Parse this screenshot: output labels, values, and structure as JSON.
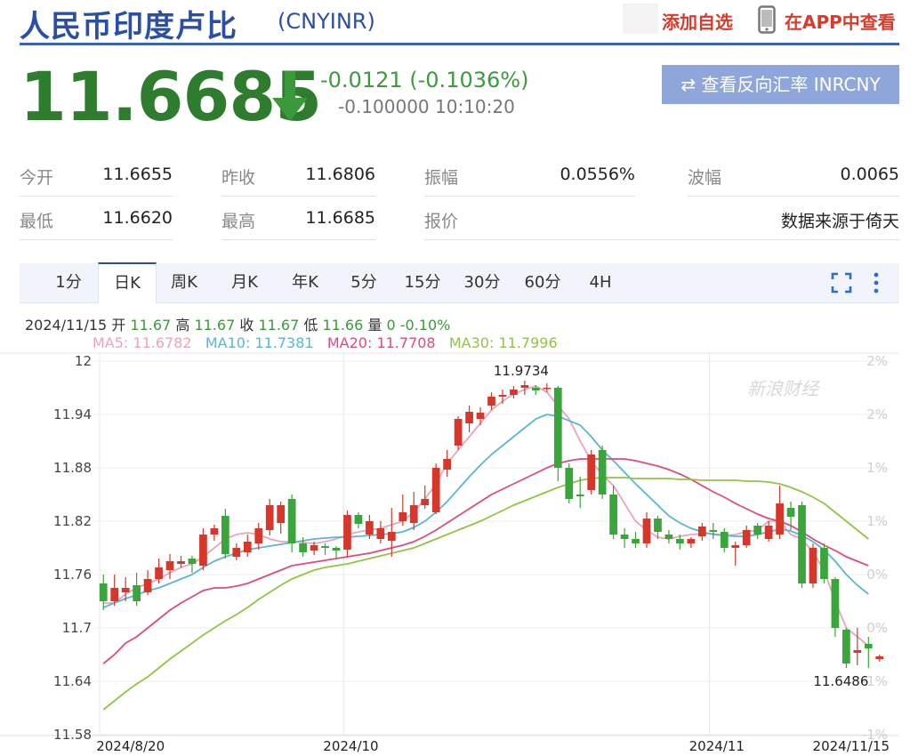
{
  "header": {
    "title": "人民币印度卢比",
    "code": "(CNYINR)",
    "add_watch": "添加自选",
    "app_view": "在APP中查看"
  },
  "quote": {
    "price": "11.6685",
    "change": "-0.0121 (-0.1036%)",
    "sub": "-0.100000 10:10:20",
    "reverse_label": "⇄ 查看反向汇率 INRCNY",
    "direction": "down",
    "color_down": "#2e7d2e"
  },
  "stats": {
    "open_label": "今开",
    "open": "11.6655",
    "prev_close_label": "昨收",
    "prev_close": "11.6806",
    "amplitude_label": "振幅",
    "amplitude": "0.0556%",
    "wave_label": "波幅",
    "wave": "0.0065",
    "low_label": "最低",
    "low": "11.6620",
    "high_label": "最高",
    "high": "11.6685",
    "quote_label": "报价",
    "source": "数据来源于倚天"
  },
  "tabs": [
    "1分",
    "日K",
    "周K",
    "月K",
    "年K",
    "5分",
    "15分",
    "30分",
    "60分",
    "4H"
  ],
  "active_tab": "日K",
  "chart_info": {
    "date": "2024/11/15",
    "open_label": "开",
    "open": "11.67",
    "high_label": "高",
    "high": "11.67",
    "close_label": "收",
    "close": "11.67",
    "low_label": "低",
    "low": "11.66",
    "vol_label": "量",
    "vol": "0",
    "pct": "-0.10%",
    "ma5": "MA5: 11.6782",
    "ma10": "MA10: 11.7381",
    "ma20": "MA20: 11.7708",
    "ma30": "MA30: 11.7996"
  },
  "chart_data": {
    "type": "candlestick",
    "watermark": "新浪财经",
    "ylim": [
      11.58,
      12.0
    ],
    "yticks": [
      "12",
      "11.94",
      "11.88",
      "11.82",
      "11.76",
      "11.7",
      "11.64",
      "11.58"
    ],
    "pct_ticks": [
      "2%",
      "2%",
      "1%",
      "1%",
      "0%",
      "0%",
      "-1%",
      "-1%"
    ],
    "xticks": [
      "2024/8/20",
      "2024/10",
      "2024/11",
      "2024/11/15"
    ],
    "max_label": "11.9734",
    "min_label": "11.6486",
    "colors": {
      "up": "#d6372a",
      "down": "#3aa53a",
      "ma5": "#eea3b8",
      "ma10": "#58b6d6",
      "ma20": "#dd4c7c",
      "ma30": "#93c446"
    },
    "candles": [
      [
        11.75,
        11.73,
        11.76,
        11.72
      ],
      [
        11.73,
        11.745,
        11.76,
        11.725
      ],
      [
        11.74,
        11.745,
        11.757,
        11.73
      ],
      [
        11.748,
        11.73,
        11.762,
        11.725
      ],
      [
        11.74,
        11.755,
        11.765,
        11.737
      ],
      [
        11.755,
        11.768,
        11.778,
        11.75
      ],
      [
        11.765,
        11.775,
        11.783,
        11.755
      ],
      [
        11.772,
        11.775,
        11.781,
        11.768
      ],
      [
        11.778,
        11.772,
        11.781,
        11.762
      ],
      [
        11.77,
        11.805,
        11.812,
        11.765
      ],
      [
        11.805,
        11.812,
        11.816,
        11.798
      ],
      [
        11.826,
        11.783,
        11.834,
        11.778
      ],
      [
        11.78,
        11.79,
        11.795,
        11.776
      ],
      [
        11.785,
        11.797,
        11.805,
        11.78
      ],
      [
        11.795,
        11.812,
        11.818,
        11.788
      ],
      [
        11.81,
        11.838,
        11.845,
        11.804
      ],
      [
        11.818,
        11.838,
        11.842,
        11.806
      ],
      [
        11.845,
        11.795,
        11.85,
        11.785
      ],
      [
        11.795,
        11.785,
        11.802,
        11.78
      ],
      [
        11.787,
        11.793,
        11.797,
        11.782
      ],
      [
        11.792,
        11.79,
        11.795,
        11.782
      ],
      [
        11.79,
        11.787,
        11.792,
        11.778
      ],
      [
        11.788,
        11.827,
        11.832,
        11.78
      ],
      [
        11.827,
        11.817,
        11.83,
        11.812
      ],
      [
        11.805,
        11.82,
        11.827,
        11.8
      ],
      [
        11.8,
        11.812,
        11.82,
        11.795
      ],
      [
        11.798,
        11.808,
        11.835,
        11.78
      ],
      [
        11.82,
        11.83,
        11.85,
        11.815
      ],
      [
        11.818,
        11.838,
        11.853,
        11.81
      ],
      [
        11.838,
        11.845,
        11.86,
        11.834
      ],
      [
        11.83,
        11.88,
        11.885,
        11.828
      ],
      [
        11.878,
        11.89,
        11.9,
        11.87
      ],
      [
        11.905,
        11.935,
        11.938,
        11.9
      ],
      [
        11.93,
        11.943,
        11.95,
        11.92
      ],
      [
        11.935,
        11.942,
        11.948,
        11.928
      ],
      [
        11.95,
        11.96,
        11.965,
        11.945
      ],
      [
        11.96,
        11.962,
        11.968,
        11.952
      ],
      [
        11.962,
        11.968,
        11.972,
        11.958
      ],
      [
        11.97,
        11.973,
        11.978,
        11.962
      ],
      [
        11.97,
        11.967,
        11.973,
        11.962
      ],
      [
        11.97,
        11.97,
        11.975,
        11.965
      ],
      [
        11.97,
        11.88,
        11.972,
        11.865
      ],
      [
        11.88,
        11.845,
        11.885,
        11.84
      ],
      [
        11.85,
        11.848,
        11.87,
        11.835
      ],
      [
        11.855,
        11.895,
        11.9,
        11.85
      ],
      [
        11.9,
        11.85,
        11.905,
        11.845
      ],
      [
        11.85,
        11.805,
        11.86,
        11.8
      ],
      [
        11.805,
        11.8,
        11.812,
        11.79
      ],
      [
        11.8,
        11.795,
        11.808,
        11.79
      ],
      [
        11.795,
        11.823,
        11.83,
        11.79
      ],
      [
        11.823,
        11.808,
        11.826,
        11.8
      ],
      [
        11.805,
        11.8,
        11.81,
        11.795
      ],
      [
        11.8,
        11.795,
        11.805,
        11.788
      ],
      [
        11.795,
        11.8,
        11.802,
        11.79
      ],
      [
        11.803,
        11.814,
        11.818,
        11.798
      ],
      [
        11.81,
        11.808,
        11.818,
        11.8
      ],
      [
        11.808,
        11.79,
        11.812,
        11.785
      ],
      [
        11.79,
        11.793,
        11.797,
        11.77
      ],
      [
        11.793,
        11.81,
        11.815,
        11.79
      ],
      [
        11.815,
        11.805,
        11.818,
        11.8
      ],
      [
        11.8,
        11.815,
        11.82,
        11.797
      ],
      [
        11.805,
        11.84,
        11.86,
        11.8
      ],
      [
        11.835,
        11.825,
        11.842,
        11.81
      ],
      [
        11.838,
        11.75,
        11.842,
        11.745
      ],
      [
        11.75,
        11.79,
        11.795,
        11.745
      ],
      [
        11.79,
        11.755,
        11.795,
        11.75
      ],
      [
        11.755,
        11.7,
        11.757,
        11.69
      ],
      [
        11.698,
        11.66,
        11.7,
        11.655
      ],
      [
        11.672,
        11.675,
        11.7,
        11.658
      ],
      [
        11.682,
        11.677,
        11.69,
        11.655
      ],
      [
        11.665,
        11.668,
        11.67,
        11.662
      ]
    ],
    "series": [
      {
        "name": "MA5",
        "values": [
          11.728,
          11.728,
          11.738,
          11.745,
          11.75,
          11.755,
          11.762,
          11.768,
          11.772,
          11.78,
          11.79,
          11.8,
          11.805,
          11.807,
          11.805,
          11.8,
          11.797,
          11.797,
          11.796,
          11.795,
          11.797,
          11.8,
          11.805,
          11.808,
          11.81,
          11.812,
          11.816,
          11.82,
          11.83,
          11.845,
          11.862,
          11.885,
          11.9,
          11.915,
          11.93,
          11.945,
          11.955,
          11.963,
          11.968,
          11.972,
          11.965,
          11.95,
          11.935,
          11.91,
          11.888,
          11.872,
          11.86,
          11.84,
          11.82,
          11.81,
          11.802,
          11.8,
          11.803,
          11.805,
          11.806,
          11.806,
          11.804,
          11.805,
          11.808,
          11.81,
          11.82,
          11.82,
          11.805,
          11.8,
          11.785,
          11.765,
          11.73,
          11.7,
          11.69,
          11.68
        ]
      },
      {
        "name": "MA10",
        "values": [
          11.723,
          11.728,
          11.733,
          11.737,
          11.742,
          11.745,
          11.75,
          11.755,
          11.76,
          11.768,
          11.775,
          11.78,
          11.784,
          11.788,
          11.79,
          11.792,
          11.794,
          11.796,
          11.798,
          11.8,
          11.801,
          11.802,
          11.802,
          11.803,
          11.804,
          11.805,
          11.806,
          11.808,
          11.813,
          11.82,
          11.83,
          11.842,
          11.856,
          11.87,
          11.883,
          11.895,
          11.905,
          11.915,
          11.925,
          11.935,
          11.94,
          11.938,
          11.933,
          11.928,
          11.915,
          11.9,
          11.888,
          11.875,
          11.862,
          11.85,
          11.838,
          11.826,
          11.818,
          11.812,
          11.808,
          11.805,
          11.804,
          11.803,
          11.803,
          11.805,
          11.808,
          11.811,
          11.809,
          11.804,
          11.797,
          11.788,
          11.775,
          11.76,
          11.748,
          11.738
        ]
      },
      {
        "name": "MA20",
        "values": [
          11.66,
          11.67,
          11.683,
          11.69,
          11.7,
          11.71,
          11.72,
          11.728,
          11.735,
          11.742,
          11.745,
          11.745,
          11.747,
          11.75,
          11.755,
          11.76,
          11.765,
          11.77,
          11.772,
          11.774,
          11.776,
          11.778,
          11.78,
          11.782,
          11.784,
          11.787,
          11.79,
          11.793,
          11.797,
          11.803,
          11.81,
          11.818,
          11.826,
          11.834,
          11.842,
          11.85,
          11.856,
          11.862,
          11.868,
          11.874,
          11.88,
          11.885,
          11.888,
          11.89,
          11.89,
          11.89,
          11.89,
          11.89,
          11.888,
          11.885,
          11.882,
          11.878,
          11.873,
          11.867,
          11.86,
          11.853,
          11.847,
          11.84,
          11.834,
          11.828,
          11.823,
          11.82,
          11.815,
          11.808,
          11.8,
          11.793,
          11.787,
          11.78,
          11.775,
          11.77
        ]
      },
      {
        "name": "MA30",
        "values": [
          11.608,
          11.618,
          11.628,
          11.637,
          11.645,
          11.655,
          11.665,
          11.674,
          11.683,
          11.692,
          11.7,
          11.708,
          11.715,
          11.723,
          11.732,
          11.74,
          11.748,
          11.755,
          11.76,
          11.765,
          11.768,
          11.77,
          11.772,
          11.775,
          11.778,
          11.781,
          11.784,
          11.787,
          11.79,
          11.795,
          11.8,
          11.805,
          11.81,
          11.815,
          11.82,
          11.826,
          11.832,
          11.838,
          11.843,
          11.848,
          11.853,
          11.858,
          11.862,
          11.866,
          11.868,
          11.869,
          11.869,
          11.869,
          11.868,
          11.868,
          11.868,
          11.868,
          11.867,
          11.867,
          11.866,
          11.866,
          11.866,
          11.866,
          11.865,
          11.865,
          11.864,
          11.862,
          11.858,
          11.853,
          11.847,
          11.84,
          11.83,
          11.82,
          11.81,
          11.8
        ]
      }
    ]
  }
}
